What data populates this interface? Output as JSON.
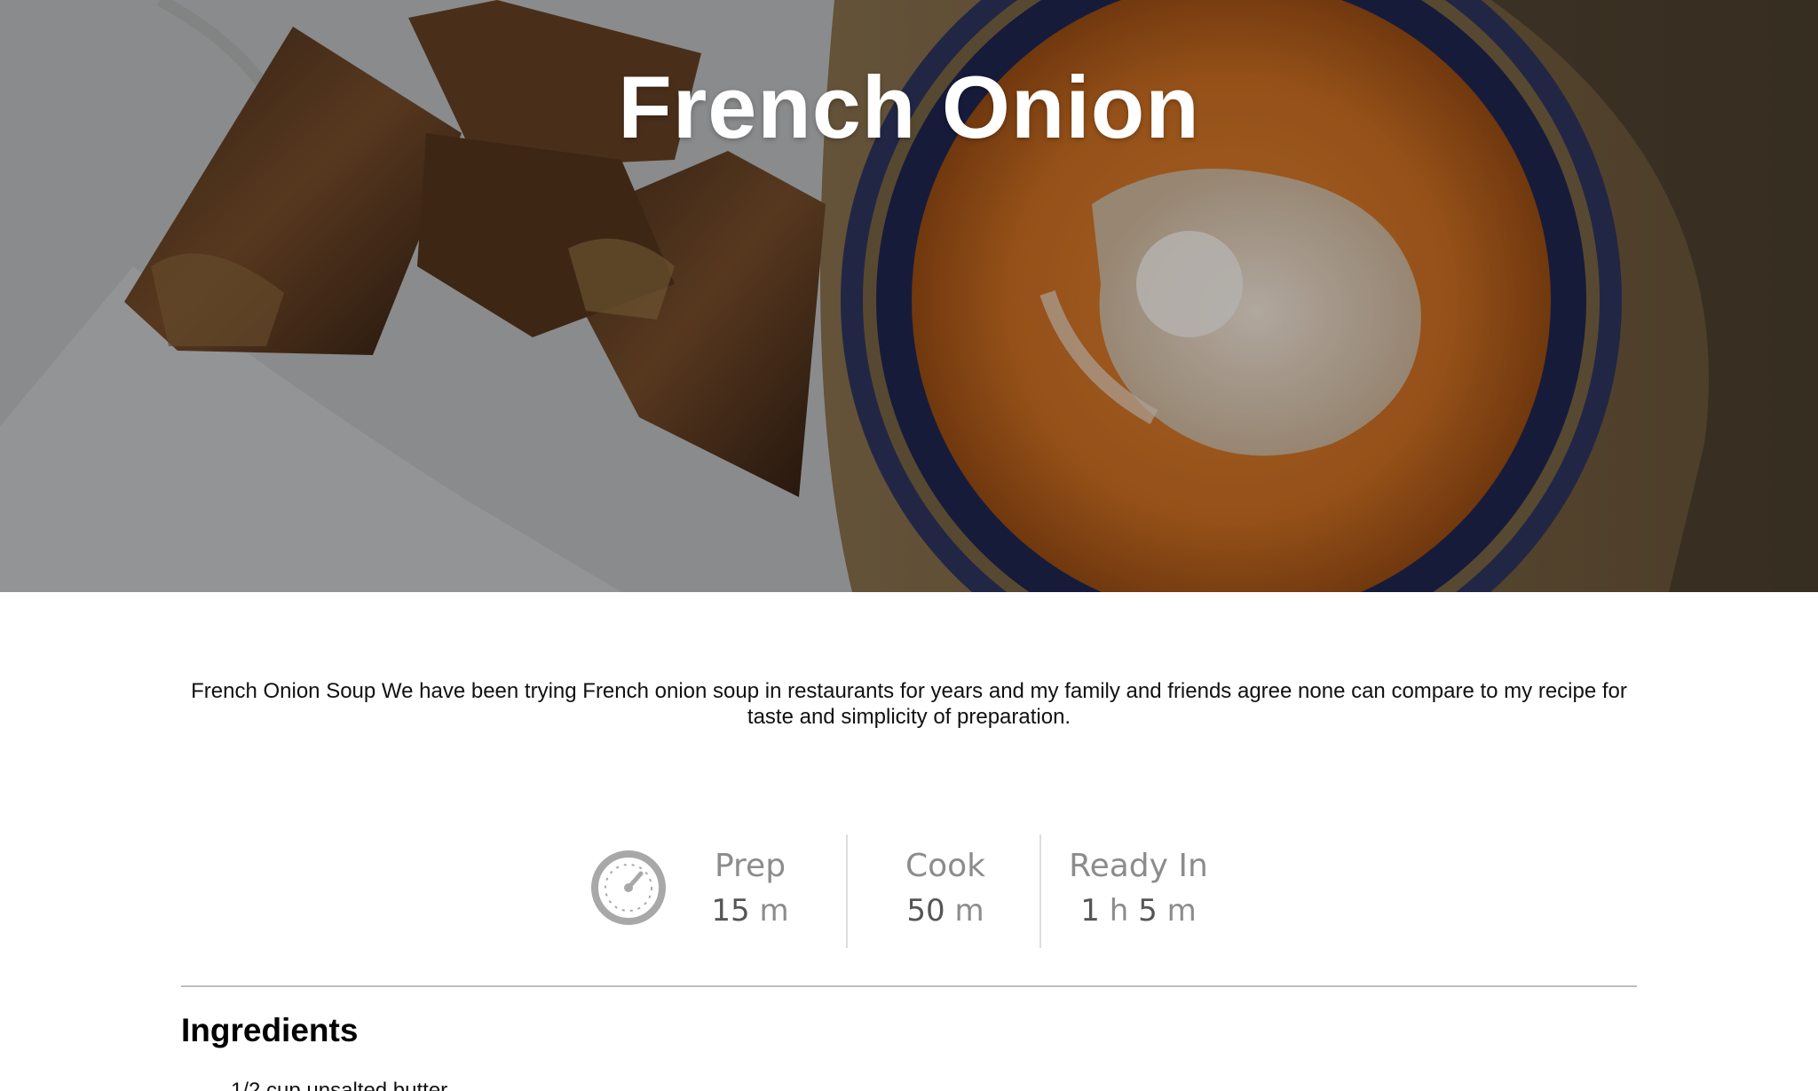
{
  "hero": {
    "title": "French Onion"
  },
  "description": "French Onion Soup We have been trying French onion soup in restaurants for years and my family and friends agree none can compare to my recipe for taste and simplicity of preparation.",
  "times": {
    "prep": {
      "label": "Prep",
      "value_num": "15",
      "value_unit": "m"
    },
    "cook": {
      "label": "Cook",
      "value_num": "50",
      "value_unit": "m"
    },
    "ready": {
      "label": "Ready In",
      "h_num": "1",
      "h_unit": "h",
      "m_num": "5",
      "m_unit": "m"
    }
  },
  "ingredients": {
    "heading": "Ingredients",
    "items": [
      "1/2 cup unsalted butter"
    ]
  },
  "icons": {
    "clock": "clock-icon"
  }
}
